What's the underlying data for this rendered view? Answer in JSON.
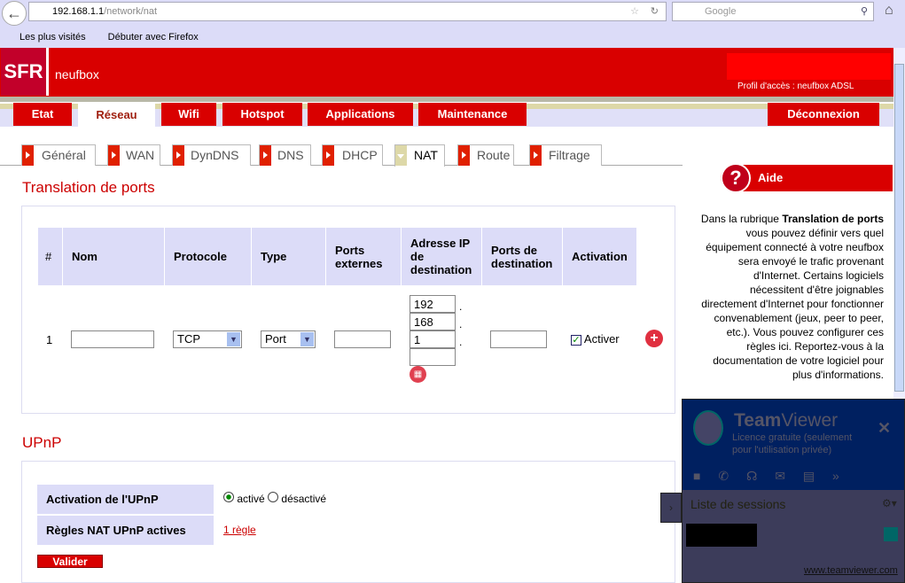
{
  "browser": {
    "url_host": "192.168.1.1",
    "url_path": "/network/nat",
    "search_placeholder": "Google",
    "bookmarks": [
      "Les plus visités",
      "Débuter avec Firefox"
    ]
  },
  "header": {
    "logo": "SFR",
    "product": "neufbox",
    "profile": "Profil d'accès : neufbox ADSL"
  },
  "nav": [
    {
      "label": "Etat"
    },
    {
      "label": "Réseau",
      "active": true
    },
    {
      "label": "Wifi"
    },
    {
      "label": "Hotspot"
    },
    {
      "label": "Applications"
    },
    {
      "label": "Maintenance"
    }
  ],
  "logout": "Déconnexion",
  "subtabs": [
    {
      "label": "Général"
    },
    {
      "label": "WAN"
    },
    {
      "label": "DynDNS"
    },
    {
      "label": "DNS"
    },
    {
      "label": "DHCP"
    },
    {
      "label": "NAT",
      "active": true
    },
    {
      "label": "Route"
    },
    {
      "label": "Filtrage"
    }
  ],
  "nat": {
    "title": "Translation de ports",
    "headers": [
      "#",
      "Nom",
      "Protocole",
      "Type",
      "Ports externes",
      "Adresse IP de destination",
      "Ports de destination",
      "Activation"
    ],
    "row": {
      "index": "1",
      "name": "",
      "protocol": "TCP",
      "type": "Port",
      "ext_ports": "",
      "ip": [
        "192",
        "168",
        "1",
        ""
      ],
      "dest_ports": "",
      "active": true,
      "active_label": "Activer"
    }
  },
  "upnp": {
    "title": "UPnP",
    "activation_label": "Activation de l'UPnP",
    "option_on": "activé",
    "option_off": "désactivé",
    "selected": "activé",
    "rules_label": "Règles NAT UPnP actives",
    "rules_link": "1 règle",
    "submit": "Valider"
  },
  "help": {
    "title": "Aide",
    "text_pre": "Dans la rubrique ",
    "text_bold": "Translation de ports",
    "text_post": " vous pouvez définir vers quel équipement connecté à votre neufbox sera envoyé le trafic provenant d'Internet. Certains logiciels nécessitent d'être joignables directement d'Internet pour fonctionner convenablement (jeux, peer to peer, etc.). Vous pouvez configurer ces règles ici. Reportez-vous à la documentation de votre logiciel pour plus d'informations."
  },
  "teamviewer": {
    "brand_a": "Team",
    "brand_b": "Viewer",
    "license": "Licence gratuite (seulement pour l'utilisation privée)",
    "sessions": "Liste de sessions",
    "link": "www.teamviewer.com"
  },
  "colors": {
    "brand_red": "#d90000",
    "header_bg": "#dcdcf8",
    "title_red": "#cc0000"
  }
}
